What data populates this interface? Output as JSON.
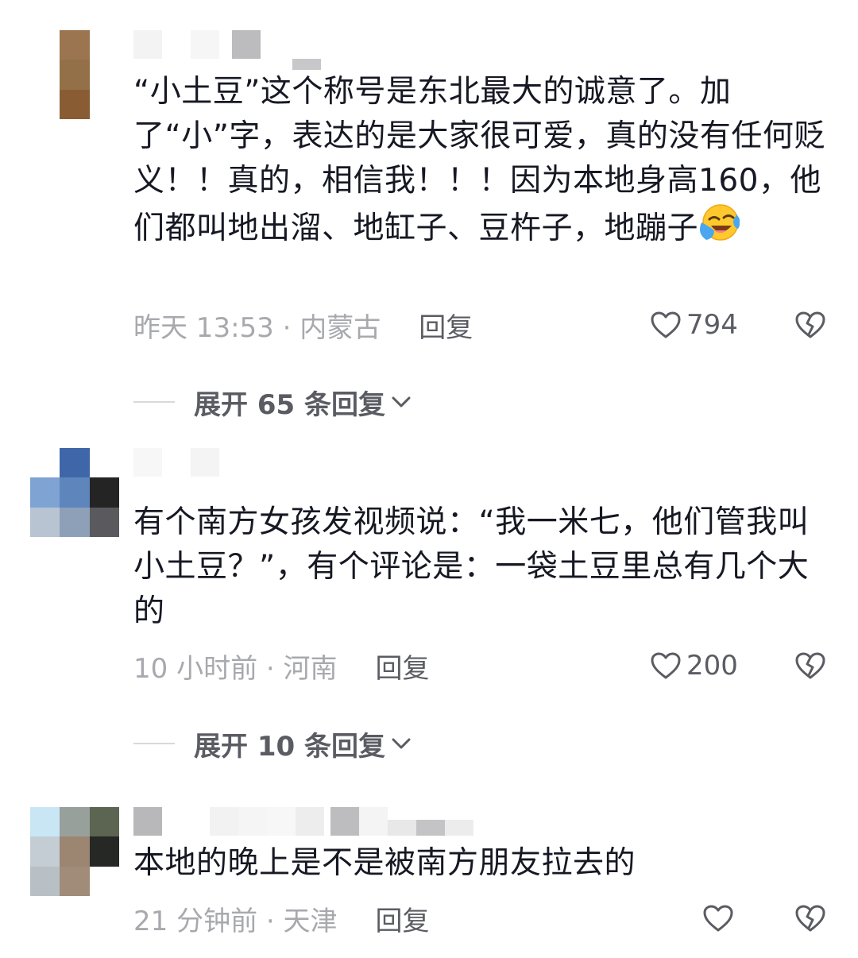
{
  "comments": [
    {
      "text": "“小土豆”这个称号是东北最大的诚意了。加了“小”字，表达的是大家很可爱，真的没有任何贬义！！真的，相信我！！！因为本地身高160，他们都叫地出溜、地缸子、豆杵子，地蹦子",
      "emoji": "laughing-crying-emoji",
      "time": "昨天 13:53 · 内蒙古",
      "reply_label": "回复",
      "likes": "794",
      "expand_label": "展开 65 条回复"
    },
    {
      "text": "有个南方女孩发视频说：“我一米七，他们管我叫小土豆？”，有个评论是：一袋土豆里总有几个大的",
      "time": "10 小时前 · 河南",
      "reply_label": "回复",
      "likes": "200",
      "expand_label": "展开 10 条回复"
    },
    {
      "text": "本地的晚上是不是被南方朋友拉去的",
      "time": "21 分钟前 · 天津",
      "reply_label": "回复",
      "likes": ""
    }
  ],
  "icons": {
    "like": "heart-outline-icon",
    "dislike": "broken-heart-icon",
    "expand": "chevron-down-icon"
  },
  "colors": {
    "text_primary": "#161823",
    "text_secondary": "#5b5c63",
    "text_muted": "#a8a9ae"
  }
}
